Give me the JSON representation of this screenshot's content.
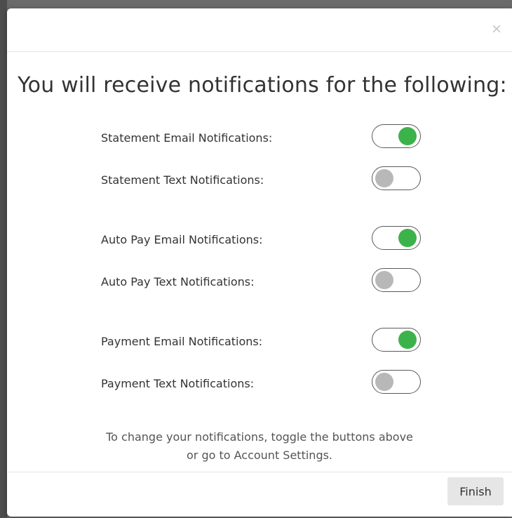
{
  "modal": {
    "close_glyph": "×",
    "title": "You will receive notifications for the following:",
    "rows": [
      {
        "label": "Statement Email Notifications:",
        "enabled": true
      },
      {
        "label": "Statement Text Notifications:",
        "enabled": false
      },
      {
        "label": "Auto Pay Email Notifications:",
        "enabled": true
      },
      {
        "label": "Auto Pay Text Notifications:",
        "enabled": false
      },
      {
        "label": "Payment Email Notifications:",
        "enabled": true
      },
      {
        "label": "Payment Text Notifications:",
        "enabled": false
      }
    ],
    "footnote_line1": "To change your notifications, toggle the buttons above",
    "footnote_line2": "or go to Account Settings.",
    "finish_label": "Finish"
  },
  "colors": {
    "toggle_on": "#3cb34a",
    "toggle_off": "#b8b8b8"
  }
}
